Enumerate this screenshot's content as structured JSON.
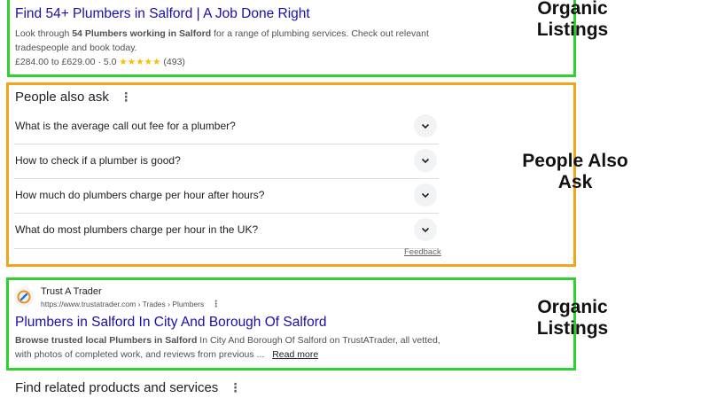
{
  "organic1": {
    "title": "Find 54+ Plumbers in Salford | A Job Done Right",
    "snippet_pre": "Look through ",
    "snippet_bold": "54 Plumbers working in Salford",
    "snippet_post": " for a range of plumbing services. Check out relevant",
    "snippet_line2": "tradespeople and book today.",
    "price": "£284.00 to £629.00",
    "sep": "·",
    "rating": "5.0",
    "stars": "★★★★★",
    "reviews": "(493)"
  },
  "paa": {
    "header": "People also ask",
    "menu_icon": "⋮",
    "questions": [
      "What is the average call out fee for a plumber?",
      "How to check if a plumber is good?",
      "How much do plumbers charge per hour after hours?",
      "What do most plumbers charge per hour in the UK?"
    ],
    "feedback": "Feedback"
  },
  "organic2": {
    "site_name": "Trust A Trader",
    "url": "https://www.trustatrader.com › Trades › Plumbers",
    "title": "Plumbers in Salford In City And Borough Of Salford",
    "snippet_bold": "Browse trusted local Plumbers in Salford",
    "snippet_post": " In City And Borough Of Salford on TrustATrader, all vetted,",
    "snippet_line2": "with photos of completed work, and reviews from previous ...",
    "read_more": "Read more"
  },
  "related": {
    "header": "Find related products and services"
  },
  "annotations": {
    "organic_top": [
      "Organic",
      "Listings"
    ],
    "paa": [
      "People Also",
      "Ask"
    ],
    "organic_bottom": [
      "Organic",
      "Listings"
    ]
  },
  "colors": {
    "green_box": "#2fd12f",
    "orange_box": "#f2a51a",
    "link_blue": "#1a0dab",
    "star_orange": "#fbbc04"
  }
}
